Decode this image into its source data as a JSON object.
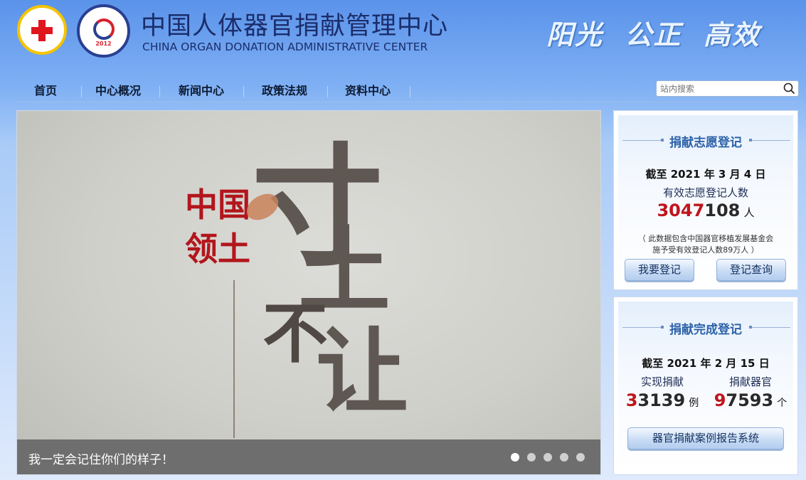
{
  "header": {
    "title_cn": "中国人体器官捐献管理中心",
    "title_en": "CHINA ORGAN DONATION ADMINISTRATIVE CENTER",
    "slogan": "阳光  公正  高效",
    "logo2_year": "2012"
  },
  "nav": {
    "items": [
      {
        "label": "首页"
      },
      {
        "label": "中心概况"
      },
      {
        "label": "新闻中心"
      },
      {
        "label": "政策法规"
      },
      {
        "label": "资料中心"
      }
    ]
  },
  "search": {
    "placeholder": "站内搜索"
  },
  "hero": {
    "art_text": {
      "small": [
        "中国",
        "领土"
      ],
      "big": [
        "寸",
        "土",
        "不",
        "让"
      ]
    },
    "caption": "我一定会记住你们的样子！",
    "dots": [
      true,
      false,
      false,
      false,
      false
    ]
  },
  "volunteer_panel": {
    "title": "捐献志愿登记",
    "date": "截至 2021 年 3 月 4 日",
    "label": "有效志愿登记人数",
    "count_red": "3047",
    "count_dark": "108",
    "unit": "人",
    "note_line1": "（ 此数据包含中国器官移植发展基金会",
    "note_line2": "施予受有效登记人数89万人 ）",
    "button_register": "我要登记",
    "button_query": "登记查询"
  },
  "completion_panel": {
    "title": "捐献完成登记",
    "date": "截至 2021 年 2 月 15 日",
    "label_donations": "实现捐献",
    "label_organs": "捐献器官",
    "donations_red": "3",
    "donations_dark": "3139",
    "donations_unit": "例",
    "organs_red": "9",
    "organs_dark": "7593",
    "organs_unit": "个",
    "button_report": "器官捐献案例报告系统"
  },
  "colors": {
    "accent_red": "#c0141c",
    "nav_text": "#0d1b33",
    "panel_title": "#2d62a8"
  }
}
